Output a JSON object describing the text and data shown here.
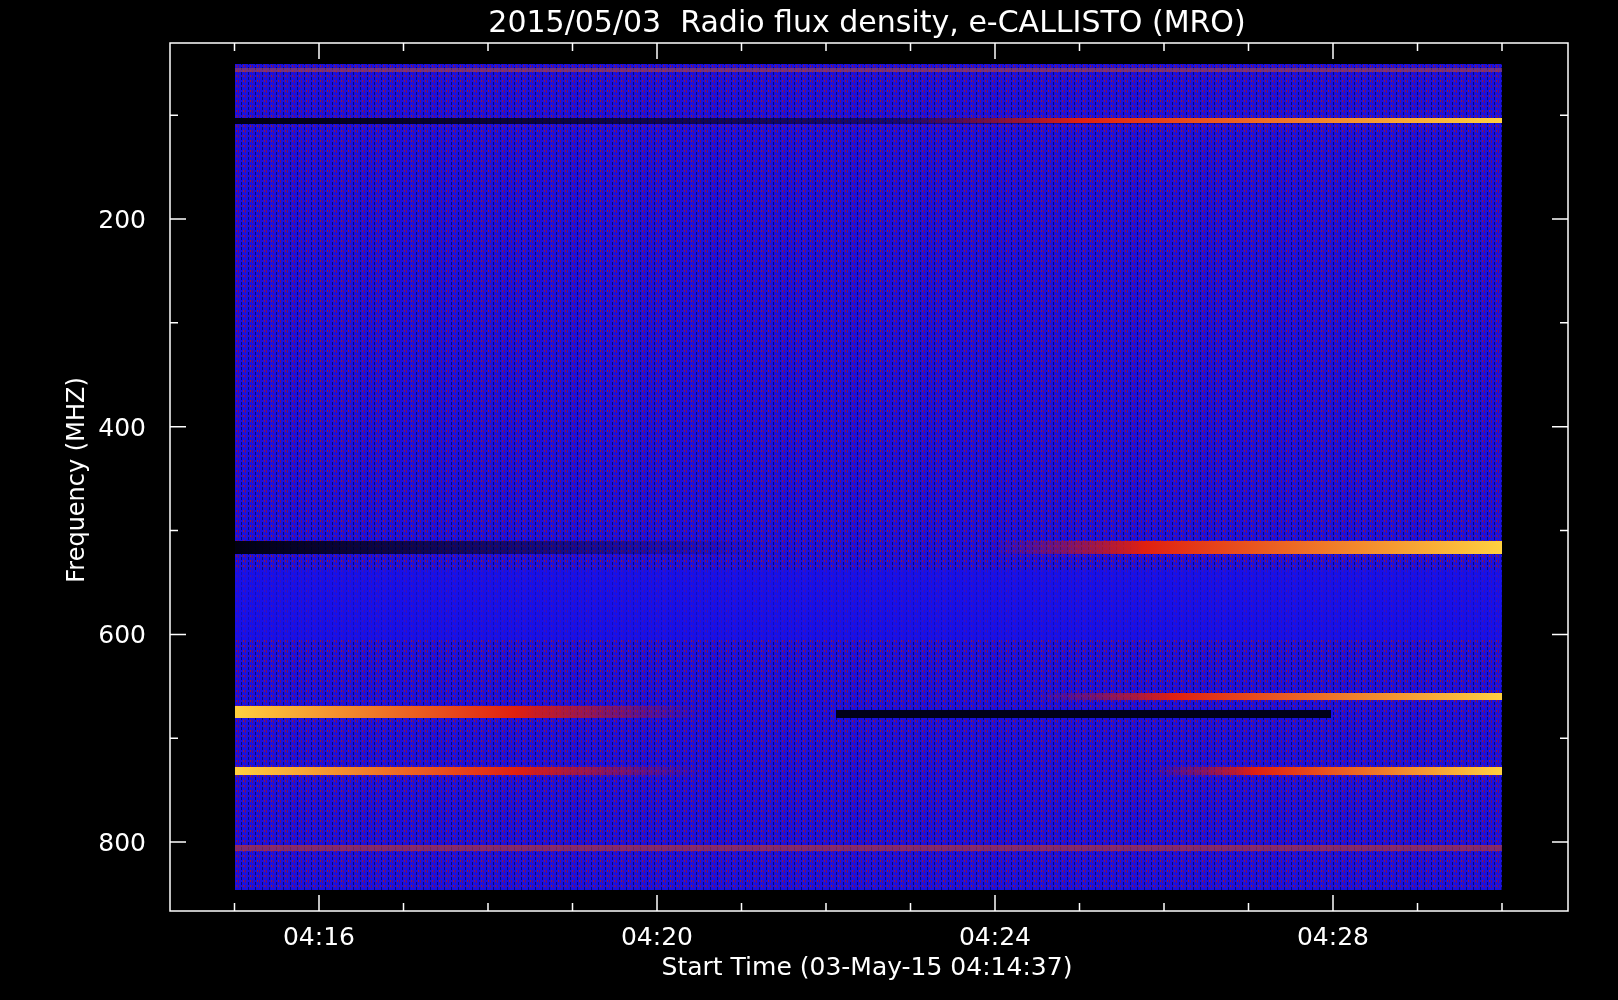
{
  "title": "2015/05/03  Radio flux density, e-CALLISTO (MRO)",
  "y_axis": {
    "label": "Frequency (MHZ)",
    "ticks": [
      "200",
      "400",
      "600",
      "800"
    ]
  },
  "x_axis": {
    "label": "Start Time (03-May-15 04:14:37)",
    "ticks": [
      "04:16",
      "04:20",
      "04:24",
      "04:28"
    ]
  }
}
